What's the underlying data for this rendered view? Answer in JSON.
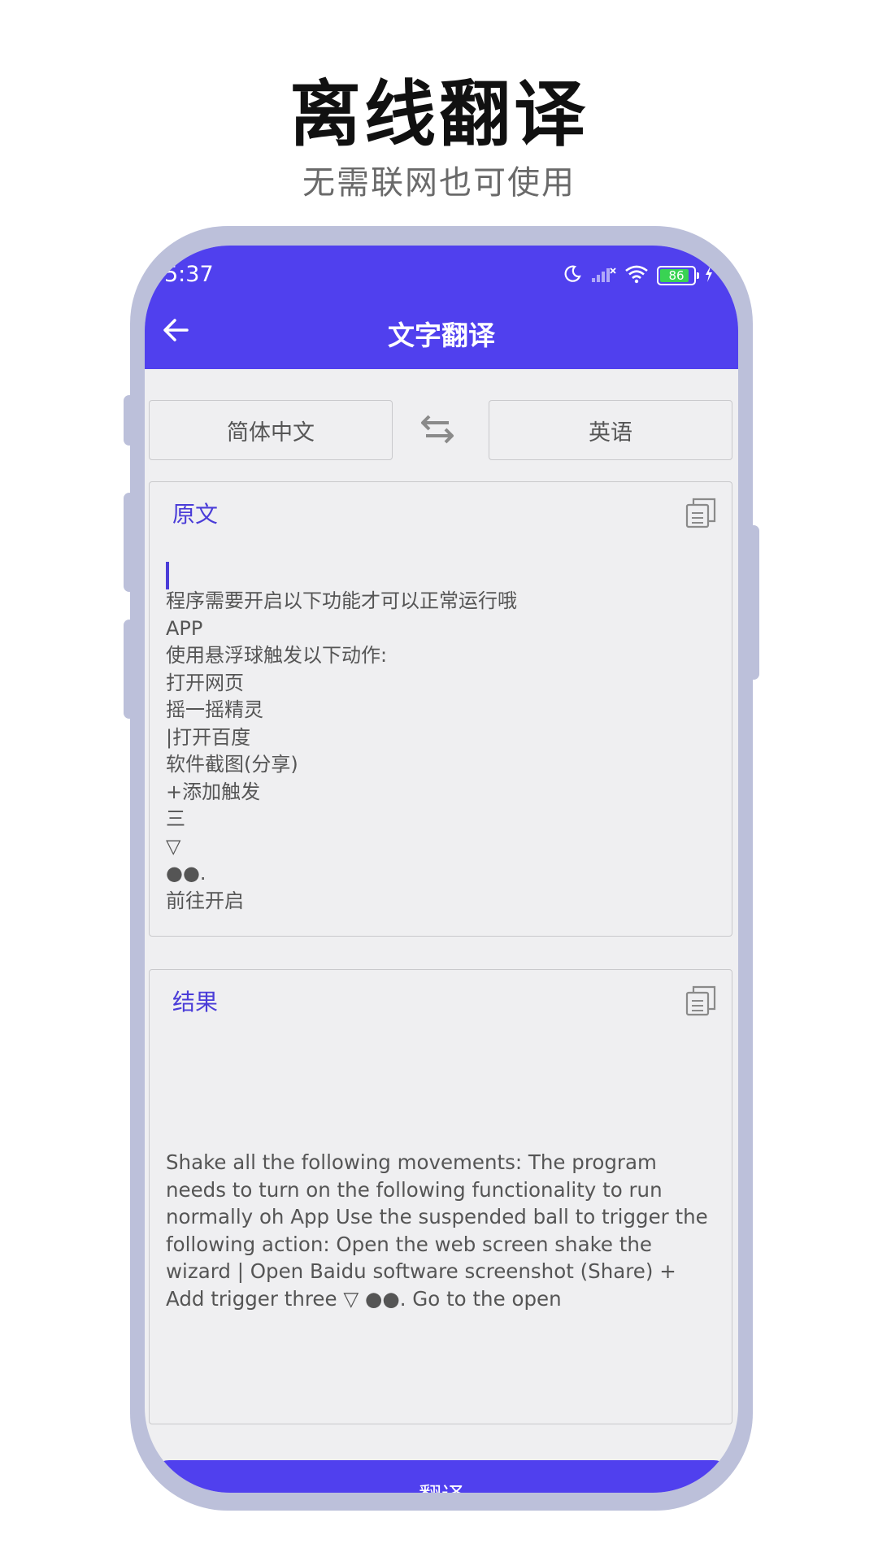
{
  "promo": {
    "title": "离线翻译",
    "subtitle": "无需联网也可使用"
  },
  "status_bar": {
    "time": "5:37",
    "battery_level": "86",
    "icons": [
      "moon-icon",
      "signal-icon",
      "wifi-icon",
      "battery-icon",
      "charging-icon"
    ]
  },
  "header": {
    "title": "文字翻译",
    "back_icon": "arrow-left-icon"
  },
  "languages": {
    "source": "简体中文",
    "target": "英语",
    "swap_icon": "swap-arrows-icon"
  },
  "source_panel": {
    "label": "原文",
    "copy_icon": "copy-icon",
    "text": "程序需要开启以下功能才可以正常运行哦\nAPP\n使用悬浮球触发以下动作:\n打开网页\n摇一摇精灵\n|打开百度\n软件截图(分享)\n+添加触发\n三\n▽\n●●.\n前往开启"
  },
  "result_panel": {
    "label": "结果",
    "copy_icon": "copy-icon",
    "text": "Shake all the following movements: The program needs to turn on the following functionality to run normally oh App Use the suspended ball to trigger the following action: Open the web screen shake the wizard | Open Baidu software screenshot (Share) + Add trigger three ▽ ●●. Go to the open"
  },
  "translate_button": {
    "label": "翻译"
  },
  "colors": {
    "primary": "#5040EE",
    "accent_text": "#4A3CD8",
    "background": "#EFEFF1",
    "frame": "#BCC0DA",
    "battery_green": "#39D353"
  }
}
